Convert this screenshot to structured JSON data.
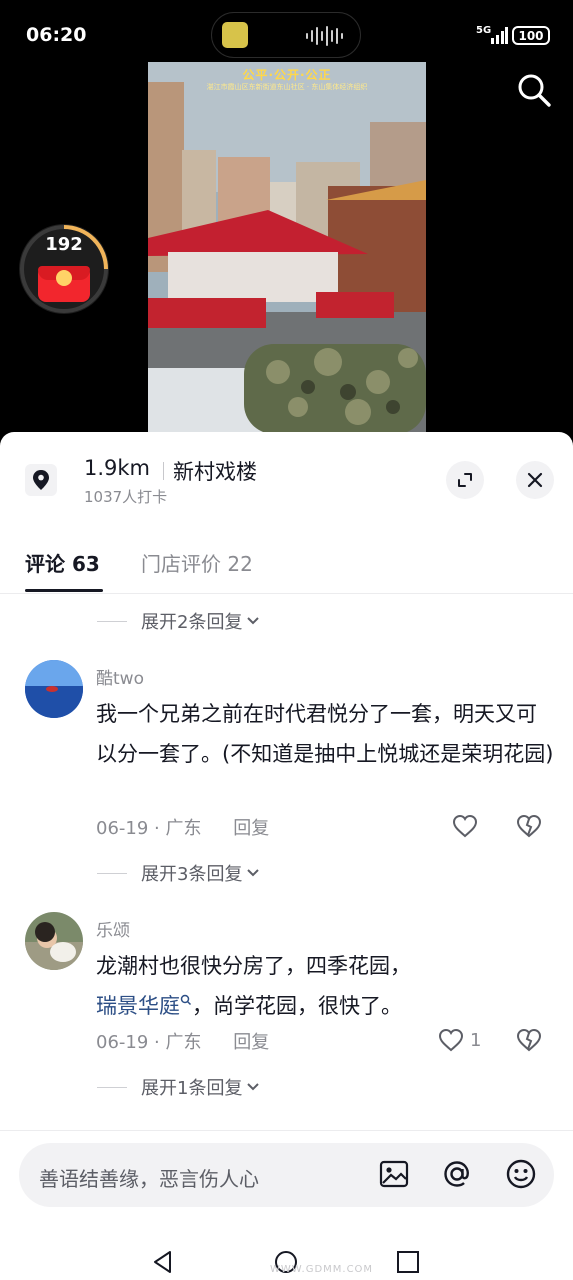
{
  "status_bar": {
    "time": "06:20",
    "network": "5G",
    "battery": "100"
  },
  "video": {
    "title": "公平·公开·公正",
    "subtitle": "湛江市霞山区东新街道东山社区 · 东山集体经济组织"
  },
  "coin_widget": {
    "count": "192"
  },
  "place": {
    "distance": "1.9km",
    "name": "新村戏楼",
    "checkins": "1037人打卡"
  },
  "tabs": [
    {
      "label": "评论 63"
    },
    {
      "label": "门店评价 22"
    }
  ],
  "expand_replies": [
    "展开2条回复",
    "展开3条回复",
    "展开1条回复"
  ],
  "comments": [
    {
      "user": "酷two",
      "text": "我一个兄弟之前在时代君悦分了一套，明天又可以分一套了。(不知道是抽中上悦城还是荣玥花园)",
      "date": "06-19 · 广东",
      "reply_label": "回复",
      "likes": ""
    },
    {
      "user": "乐颂",
      "text_before": "龙潮村也很快分房了，四季花园，",
      "link": "瑞景华庭",
      "text_after": "，尚学花园，很快了。",
      "date": "06-19 · 广东",
      "reply_label": "回复",
      "likes": "1"
    }
  ],
  "input": {
    "placeholder": "善语结善缘，恶言伤人心"
  },
  "watermark": "WWW.GDMM.COM",
  "colors": {
    "link": "#2d4f86",
    "envelope": "#f2262d",
    "accent_arc": "#f0b45a"
  }
}
